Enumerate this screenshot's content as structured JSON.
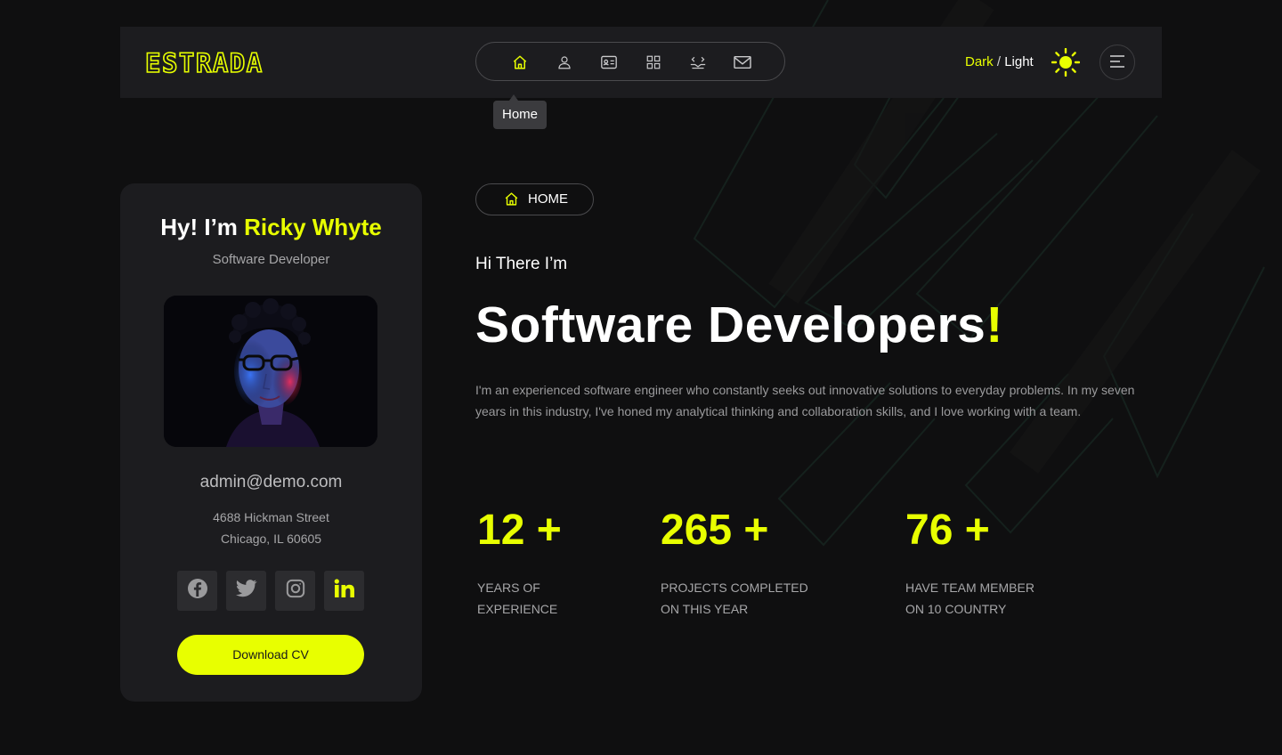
{
  "colors": {
    "accent": "#e8ff00",
    "background": "#0f0f10",
    "panel": "#1c1c1f",
    "muted": "#a6a6a8"
  },
  "header": {
    "logo": "ESTRADA",
    "nav": [
      {
        "icon": "home-icon",
        "tooltip": "Home",
        "active": true
      },
      {
        "icon": "user-icon"
      },
      {
        "icon": "id-card-icon"
      },
      {
        "icon": "grid-icon"
      },
      {
        "icon": "handshake-icon"
      },
      {
        "icon": "mail-icon"
      }
    ],
    "theme": {
      "dark": "Dark",
      "separator": " / ",
      "light": "Light"
    },
    "sun_icon": "sun-icon",
    "menu_icon": "menu-icon"
  },
  "tooltip": {
    "text": "Home"
  },
  "profile": {
    "greeting": "Hy! I’m ",
    "name": "Ricky Whyte",
    "role": "Software Developer",
    "email": "admin@demo.com",
    "address_line1": "4688 Hickman Street",
    "address_line2": "Chicago, IL 60605",
    "socials": [
      "facebook-icon",
      "twitter-icon",
      "instagram-icon",
      "linkedin-icon"
    ],
    "download_label": "Download CV"
  },
  "hero": {
    "chip_label": "HOME",
    "intro": "Hi There I’m",
    "headline": "Software Developers",
    "headline_accent": "!",
    "description": "I'm an experienced software engineer who constantly seeks out innovative solutions to everyday problems. In my seven years in this industry, I've honed my analytical thinking and collaboration skills, and I love working with a team."
  },
  "stats": [
    {
      "value": "12 +",
      "label_line1": "YEARS OF",
      "label_line2": "EXPERIENCE"
    },
    {
      "value": "265 +",
      "label_line1": "PROJECTS COMPLETED",
      "label_line2": "ON THIS YEAR"
    },
    {
      "value": "76 +",
      "label_line1": "HAVE TEAM MEMBER",
      "label_line2": "ON 10 COUNTRY"
    }
  ]
}
